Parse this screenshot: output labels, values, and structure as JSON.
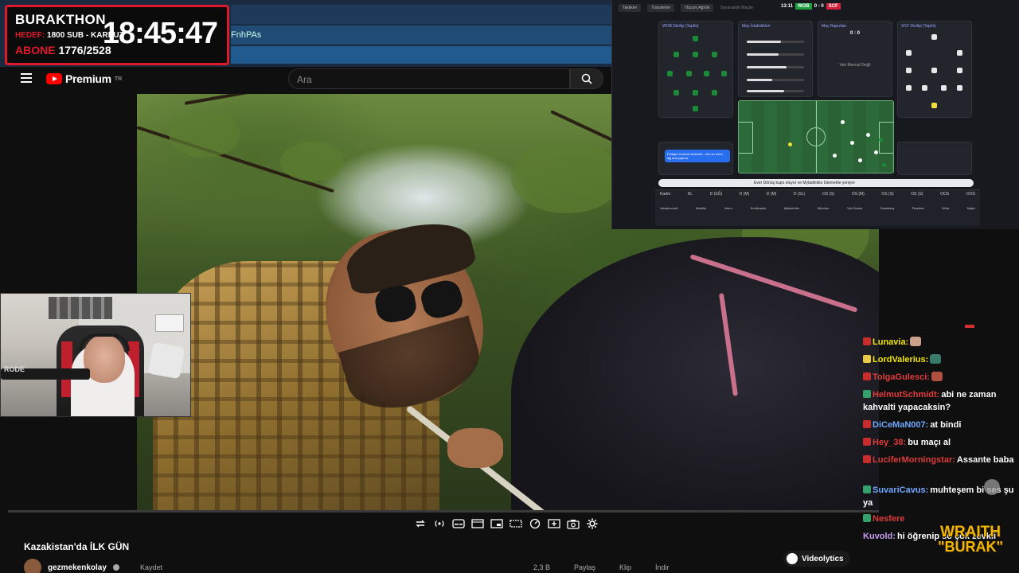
{
  "overlay": {
    "title": "BURAKTHON",
    "goal_label": "HEDEF:",
    "goal_value": "1800 SUB - KARPUZ",
    "subs_label": "ABONE",
    "subs_value": "1776/2528",
    "clock": "18:45:47",
    "accent_color": "#e0192a"
  },
  "browser": {
    "tab_text": "FnhPAs"
  },
  "youtube": {
    "brand": "Premium",
    "brand_suffix": "TR",
    "search_placeholder": "Ara",
    "video_title": "Kazakistan'da İLK GÜN",
    "channel_name": "gezmekenkolay",
    "action_share": "Kaydet",
    "action_right_1": "2,3 B",
    "action_right_2": "Paylaş",
    "action_right_3": "Klip",
    "action_right_4": "İndir",
    "icons": [
      "loop-icon",
      "live-icon",
      "subtitles-icon",
      "theater-icon",
      "pip-icon",
      "miniplayer-icon",
      "speed-icon",
      "clip-icon",
      "screenshot-icon",
      "settings-icon"
    ]
  },
  "football": {
    "score_time": "13:11",
    "home": "WOB",
    "away": "SCF",
    "score": "0 - 0",
    "panel_score": "0 : 0",
    "card_titles": [
      "WOB Dizilişi (Taptık)",
      "Maç İstatistikleri",
      "Maç Raporları",
      "SCF Dizilişi (Taptık)"
    ],
    "tab_labels": [
      "Taktikler",
      "Transferler",
      "Hücum Ağırlık",
      "Oynanabilir Maçlar"
    ],
    "not_available": "Veri Mevcut Değil",
    "news": "Ever Dönüş kupo oluyor ve Myladimiko İstemekte yeniyor",
    "table_headers": [
      "Kadro",
      "KL",
      "D (SĞ)",
      "D (M)",
      "D (M)",
      "D (SL)",
      "OS (S)",
      "OS (M)",
      "OS (S)",
      "OS (S)",
      "OOS",
      "OOS"
    ],
    "table_names": [
      "Vandevoordt",
      "Madhlu",
      "Vavro",
      "Koulierakis",
      "Mykolenko",
      "Wimmer",
      "Vini Souza",
      "Svanberg",
      "Paredes",
      "Wind",
      "Majer"
    ],
    "ticker": "Pollaja Liesfund sürücülü - oltınızı sürer dijj ana yapma",
    "colors": {
      "home": "#1ca03d",
      "away": "#d3213b",
      "pitch": "#2d6a3a"
    }
  },
  "webcam": {
    "mic_brand": "RODE"
  },
  "chat": {
    "messages": [
      {
        "user": "Lunavia:",
        "color": "#f2e500",
        "text": "",
        "badge": "#c62e2e",
        "emote": "#c9a08a"
      },
      {
        "user": "LordValerius:",
        "color": "#f2e500",
        "text": "",
        "badge": "#e8c84a",
        "emote": "#3a7a6a"
      },
      {
        "user": "TolgaGulesci:",
        "color": "#e03b3b",
        "text": "",
        "badge": "#c62e2e",
        "emote": "#b05040"
      },
      {
        "user": "HelmutSchmidt:",
        "color": "#e03b3b",
        "text": "abi ne zaman kahvalti yapacaksin?",
        "badge": "#35a06b",
        "emote": ""
      },
      {
        "user": "DiCeMaN007:",
        "color": "#6fa8ff",
        "text": "at bindi",
        "badge": "#c62e2e",
        "emote": ""
      },
      {
        "user": "Hey_38:",
        "color": "#e03b3b",
        "text": "bu maçı al",
        "badge": "#c62e2e",
        "emote": ""
      },
      {
        "user": "LuciferMorningstar:",
        "color": "#e03b3b",
        "text": "Assante baba",
        "badge": "#c62e2e",
        "emote": ""
      },
      {
        "user": "SuvariCavus:",
        "color": "#6fa8ff",
        "text": "muhteşem bi ses şu ya",
        "badge": "#35a06b",
        "emote": ""
      },
      {
        "user": "Nesfere",
        "color": "#e03b3b",
        "text": "",
        "badge": "#35a06b",
        "emote": ""
      },
      {
        "user": "Kuvold:",
        "color": "#c89ef0",
        "text": "hi öğrenip so çok zevkli",
        "badge": "",
        "emote": ""
      }
    ]
  },
  "sponsor": {
    "line1": "WRAITH",
    "line2": "\"BURAK\""
  },
  "videolytics": {
    "label": "Videolytics"
  }
}
